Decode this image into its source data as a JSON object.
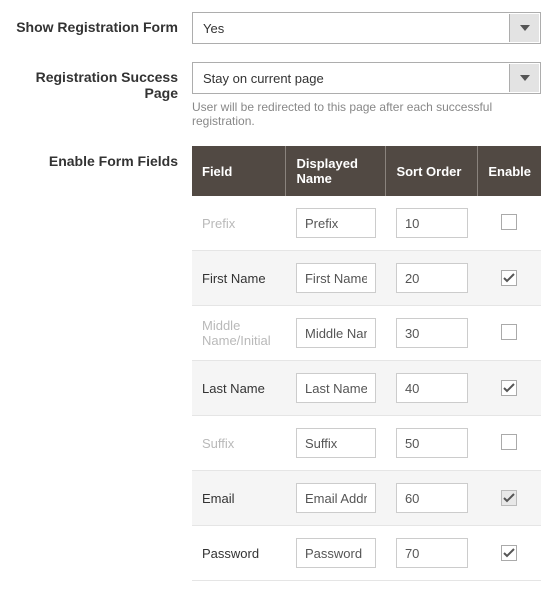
{
  "show_form": {
    "label": "Show Registration Form",
    "value": "Yes"
  },
  "success_page": {
    "label": "Registration Success Page",
    "value": "Stay on current page",
    "hint": "User will be redirected to this page after each successful registration."
  },
  "enable_fields": {
    "label": "Enable Form Fields",
    "columns": {
      "field": "Field",
      "displayed": "Displayed Name",
      "sort": "Sort Order",
      "enable": "Enable"
    },
    "rows": [
      {
        "field": "Prefix",
        "disabled": true,
        "displayed": "Prefix",
        "sort": "10",
        "checked": false,
        "locked": false
      },
      {
        "field": "First Name",
        "disabled": false,
        "displayed": "First Name",
        "sort": "20",
        "checked": true,
        "locked": false
      },
      {
        "field": "Middle Name/Initial",
        "disabled": true,
        "displayed": "Middle Nam",
        "sort": "30",
        "checked": false,
        "locked": false
      },
      {
        "field": "Last Name",
        "disabled": false,
        "displayed": "Last Name",
        "sort": "40",
        "checked": true,
        "locked": false
      },
      {
        "field": "Suffix",
        "disabled": true,
        "displayed": "Suffix",
        "sort": "50",
        "checked": false,
        "locked": false
      },
      {
        "field": "Email",
        "disabled": false,
        "displayed": "Email Addre",
        "sort": "60",
        "checked": true,
        "locked": true
      },
      {
        "field": "Password",
        "disabled": false,
        "displayed": "Password",
        "sort": "70",
        "checked": true,
        "locked": false
      }
    ]
  }
}
